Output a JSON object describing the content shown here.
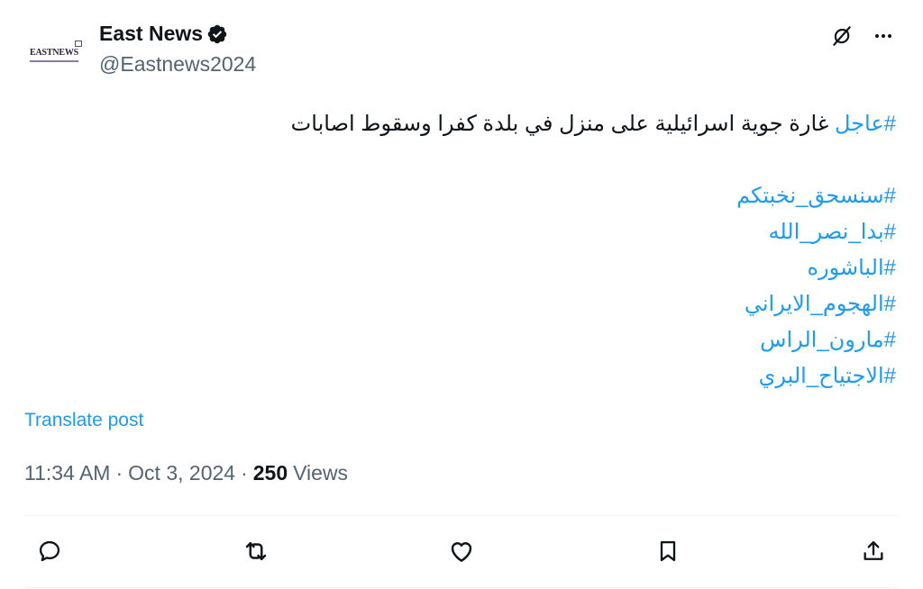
{
  "author": {
    "display_name": "East News",
    "handle": "@Eastnews2024",
    "avatar_text": "EASTNEWS",
    "verified": true
  },
  "tweet": {
    "lead_tag": "#عاجل",
    "lead_text": " غارة جوية اسرائيلية على منزل في بلدة كفرا وسقوط اصابات",
    "hashtags": [
      "#سنسحق_نخبتكم",
      "#بدا_نصر_الله",
      "#الباشوره",
      "#الهجوم_الايراني",
      "#مارون_الراس",
      "#الاجتياح_البري"
    ]
  },
  "translate_label": "Translate post",
  "meta": {
    "time": "11:34 AM",
    "separator1": "·",
    "date": "Oct 3, 2024",
    "separator2": "·",
    "views_count": "250",
    "views_label": "Views"
  },
  "icons": {
    "top": [
      "grok-icon",
      "more-icon"
    ],
    "actions": [
      "reply-icon",
      "repost-icon",
      "like-icon",
      "bookmark-icon",
      "share-icon"
    ]
  },
  "colors": {
    "link": "#1d9bf0",
    "text": "#0f1419",
    "secondary": "#536471",
    "divider": "#eff3f4"
  }
}
